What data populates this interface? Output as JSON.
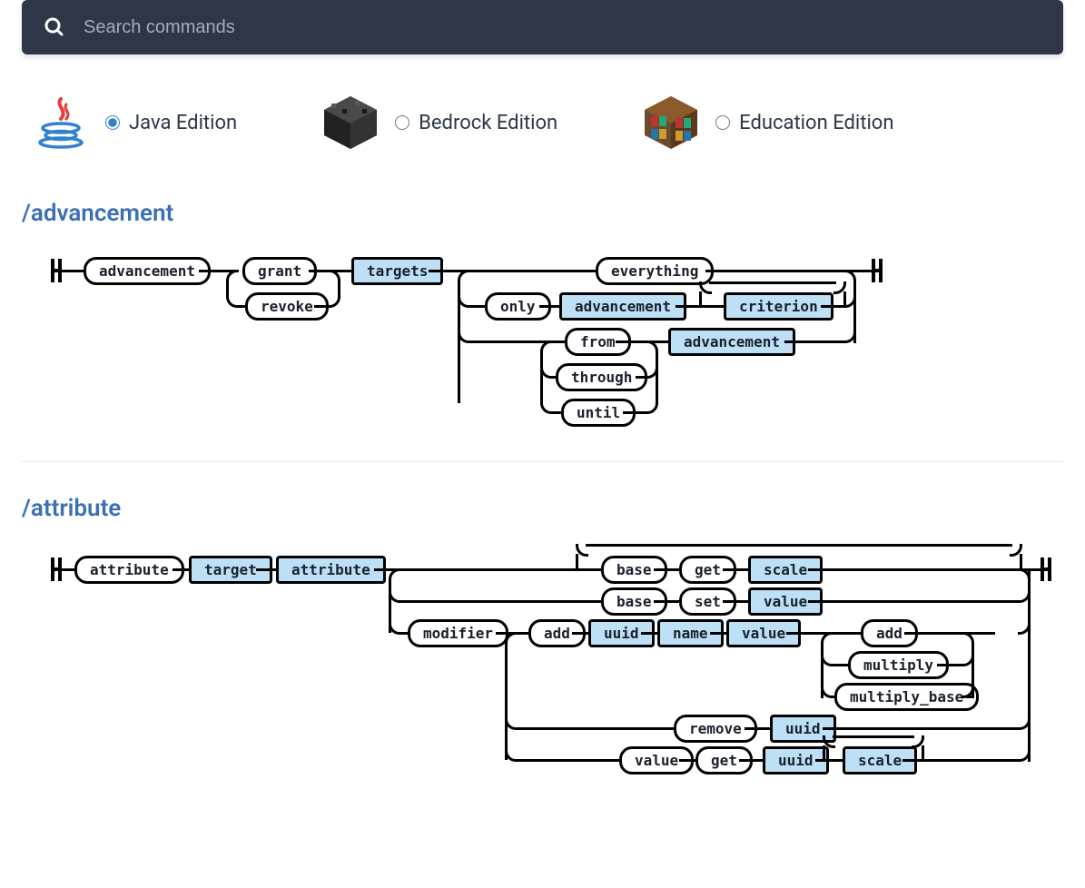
{
  "search": {
    "placeholder": "Search commands"
  },
  "editions": [
    {
      "id": "java",
      "label": "Java Edition",
      "selected": true
    },
    {
      "id": "bedrock",
      "label": "Bedrock Edition",
      "selected": false
    },
    {
      "id": "education",
      "label": "Education Edition",
      "selected": false
    }
  ],
  "commands": [
    {
      "name": "/advancement",
      "syntax_tokens": {
        "root": "advancement",
        "actions": [
          "grant",
          "revoke"
        ],
        "selector": "targets",
        "everything": "everything",
        "only": "only",
        "only_advancement": "advancement",
        "only_criterion": "criterion",
        "ranges": [
          "from",
          "through",
          "until"
        ],
        "range_advancement": "advancement"
      }
    },
    {
      "name": "/attribute",
      "syntax_tokens": {
        "root": "attribute",
        "target": "target",
        "attribute": "attribute",
        "base": "base",
        "get": "get",
        "set": "set",
        "scale": "scale",
        "value": "value",
        "modifier": "modifier",
        "add": "add",
        "uuid": "uuid",
        "name": "name",
        "op_add": "add",
        "op_multiply": "multiply",
        "op_multiply_base": "multiply_base",
        "remove": "remove",
        "mod_value": "value",
        "mod_get": "get"
      }
    }
  ]
}
